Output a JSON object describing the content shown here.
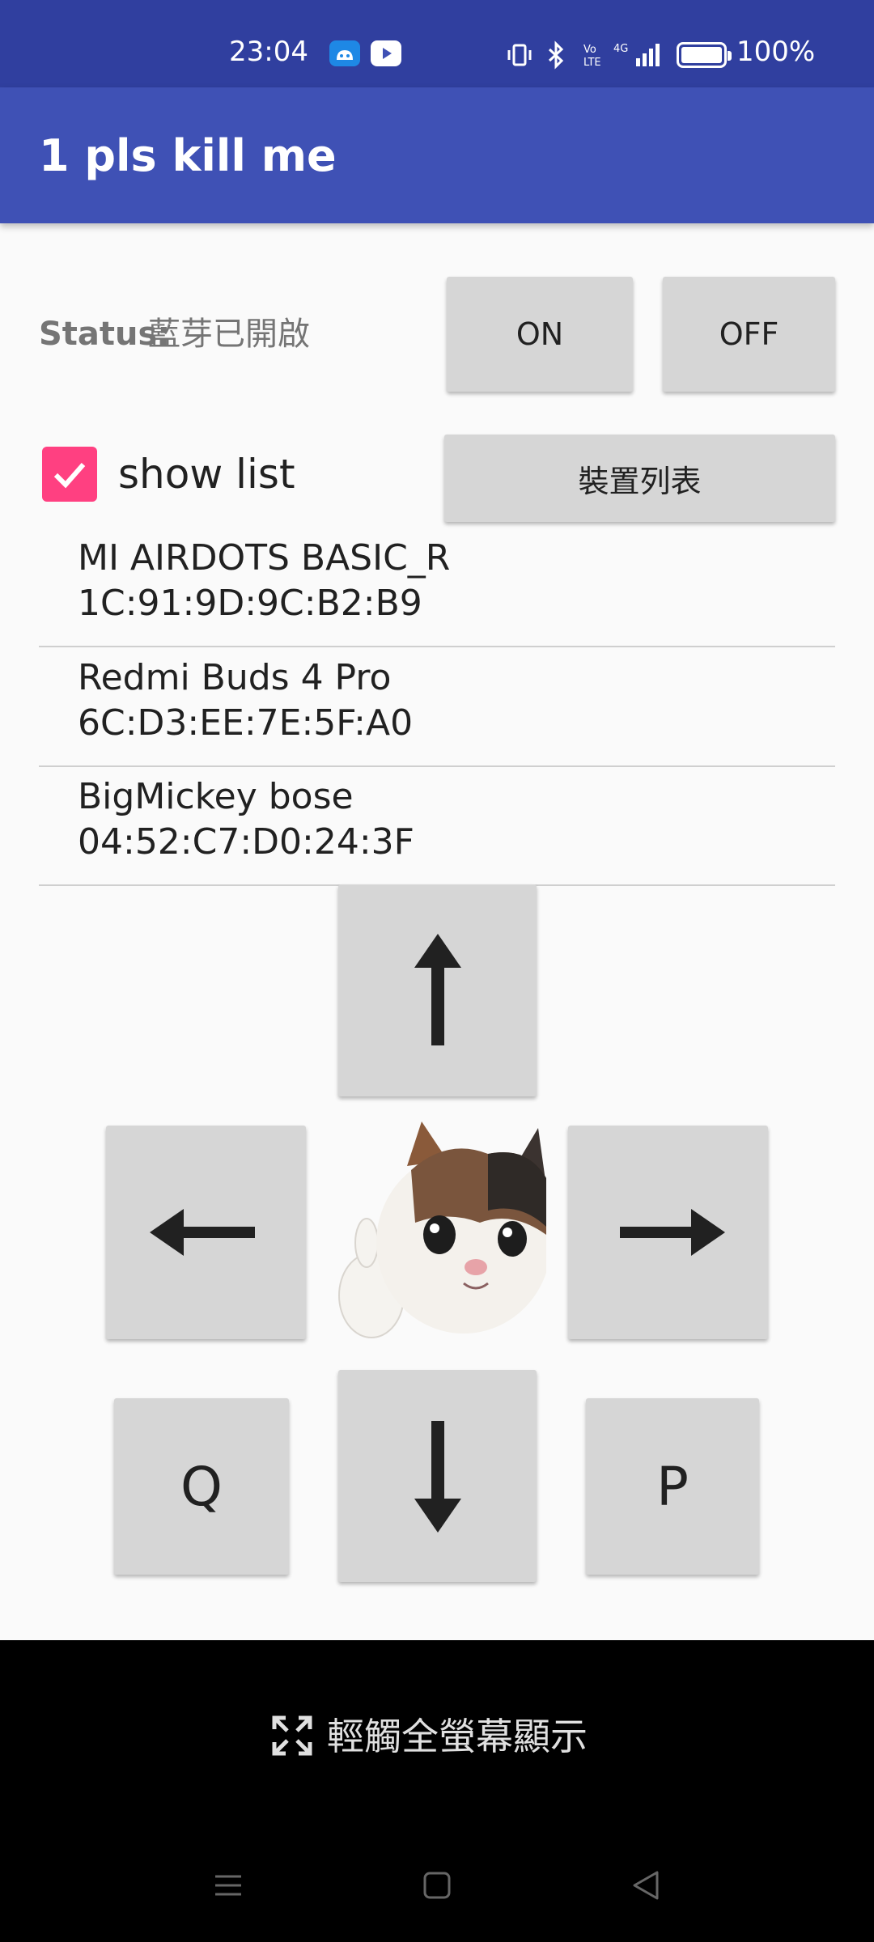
{
  "status_bar": {
    "time": "23:04",
    "app_icons": [
      "android-icon",
      "youtube-icon"
    ],
    "system_icons": [
      "vibrate-icon",
      "bluetooth-icon",
      "volte-icon",
      "4g-signal-icon",
      "battery-icon"
    ],
    "battery_percent": "100%"
  },
  "app_bar": {
    "title": "1 pls kill me"
  },
  "bluetooth": {
    "status_label": "Status:",
    "status_value": "藍芽已開啟",
    "on_label": "ON",
    "off_label": "OFF"
  },
  "list_controls": {
    "show_list_label": "show list",
    "show_list_checked": true,
    "device_list_label": "裝置列表"
  },
  "devices": [
    {
      "name": "MI AIRDOTS BASIC_R",
      "address": "1C:91:9D:9C:B2:B9"
    },
    {
      "name": "Redmi Buds 4 Pro",
      "address": "6C:D3:EE:7E:5F:A0"
    },
    {
      "name": "BigMickey bose",
      "address": "04:52:C7:D0:24:3F"
    }
  ],
  "controls": {
    "up_icon": "arrow-up-icon",
    "down_icon": "arrow-down-icon",
    "left_icon": "arrow-left-icon",
    "right_icon": "arrow-right-icon",
    "q_label": "Q",
    "p_label": "P",
    "center_image": "crying-cat-thumbs-up"
  },
  "fullscreen_prompt": {
    "label": "輕觸全螢幕顯示",
    "icon": "expand-icon"
  },
  "nav_bar": {
    "icons": [
      "menu-icon",
      "home-icon",
      "back-icon"
    ]
  },
  "colors": {
    "status_bar": "#303f9f",
    "app_bar": "#3f51b5",
    "accent": "#ff4081",
    "button": "#d6d6d6"
  }
}
